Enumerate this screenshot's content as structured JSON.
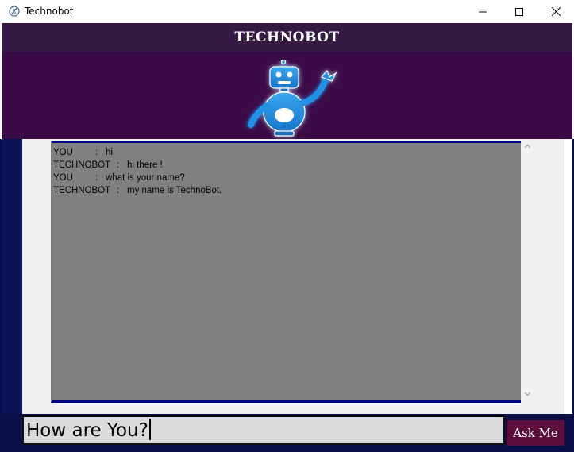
{
  "window": {
    "title": "Technobot",
    "icon": "feather-app-icon"
  },
  "header": {
    "title": "TECHNOBOT",
    "logo": "robot-mascot",
    "colors": {
      "title_band": "#371a44",
      "logo_band": "#3a0b47",
      "robot": "#1e88d8"
    }
  },
  "chat": {
    "background": "#808080",
    "messages": [
      {
        "speaker": "YOU",
        "sep": ":",
        "text": "hi"
      },
      {
        "speaker": "TECHNOBOT",
        "sep": ":",
        "text": "hi there !"
      },
      {
        "speaker": "YOU",
        "sep": ":",
        "text": "what is your name?"
      },
      {
        "speaker": "TECHNOBOT",
        "sep": ":",
        "text": "my name is TechnoBot."
      }
    ]
  },
  "input": {
    "value": "How are You?"
  },
  "ask_button": {
    "label": "Ask Me",
    "color": "#5c0d3a"
  },
  "colors": {
    "main_background": "#0b0f48",
    "accent_border": "#000080"
  }
}
